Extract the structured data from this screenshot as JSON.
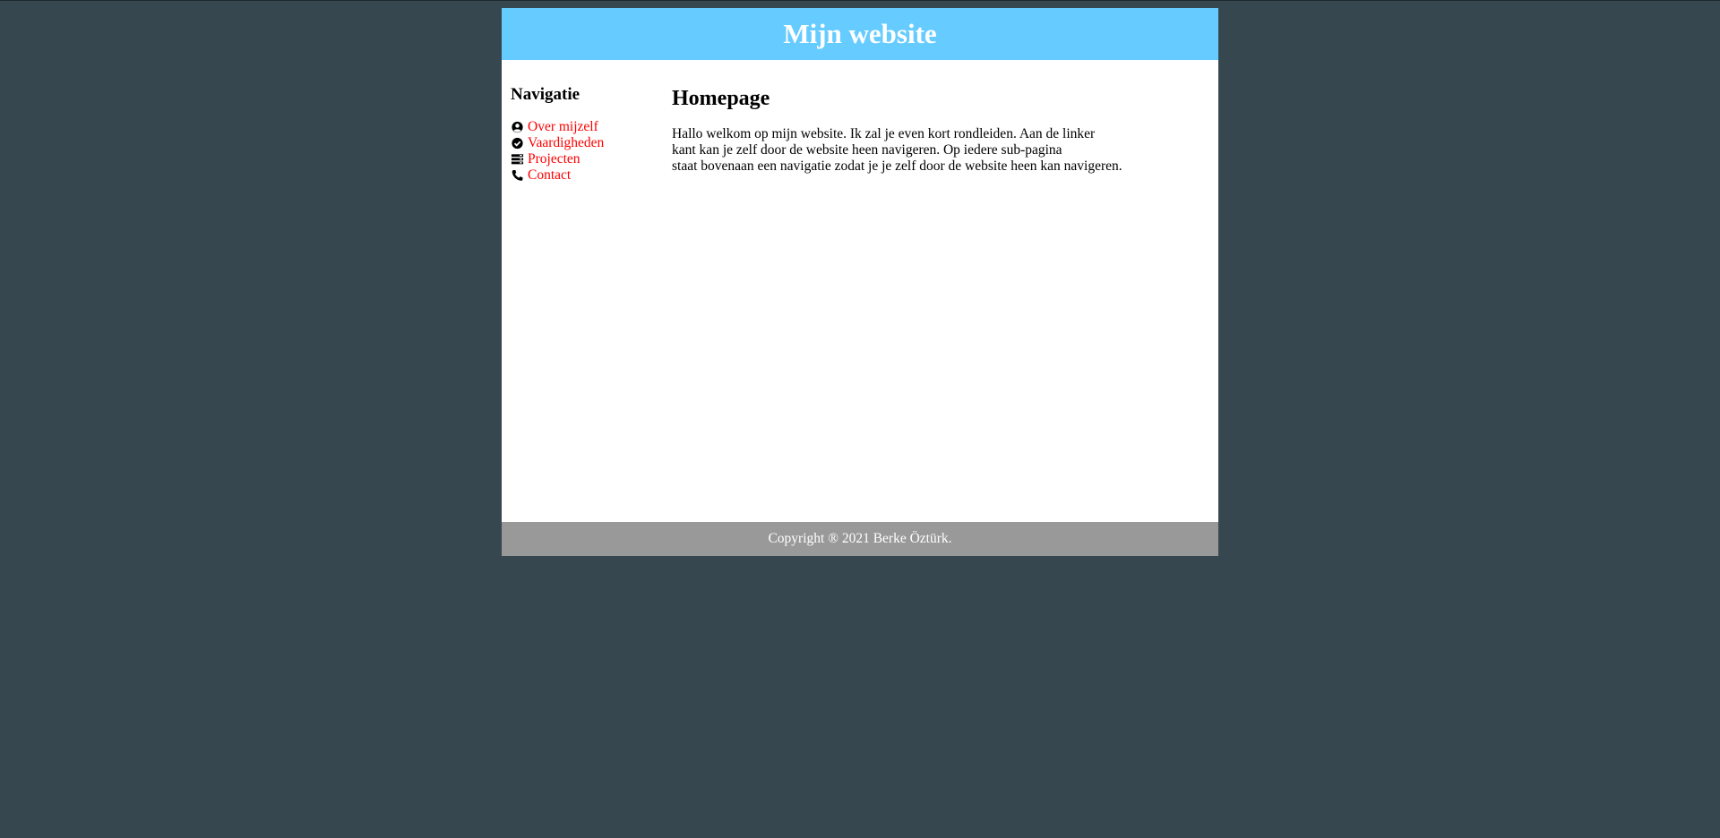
{
  "header": {
    "title": "Mijn website"
  },
  "sidebar": {
    "heading": "Navigatie",
    "items": [
      {
        "label": "Over mijzelf",
        "icon": "user-circle-icon"
      },
      {
        "label": "Vaardigheden",
        "icon": "check-circle-icon"
      },
      {
        "label": "Projecten",
        "icon": "stack-icon"
      },
      {
        "label": "Contact",
        "icon": "phone-icon"
      }
    ]
  },
  "main": {
    "title": "Homepage",
    "lines": [
      "Hallo welkom op mijn website. Ik zal je even kort rondleiden. Aan de linker",
      "kant kan je zelf door de website heen navigeren. Op iedere sub-pagina",
      "staat bovenaan een navigatie zodat je je zelf door de website heen kan navigeren."
    ]
  },
  "footer": {
    "text": "Copyright ® 2021 Berke Öztürk."
  },
  "colors": {
    "background": "#37474f",
    "header": "#66ccff",
    "footer": "#999999",
    "link": "#ff0000"
  }
}
